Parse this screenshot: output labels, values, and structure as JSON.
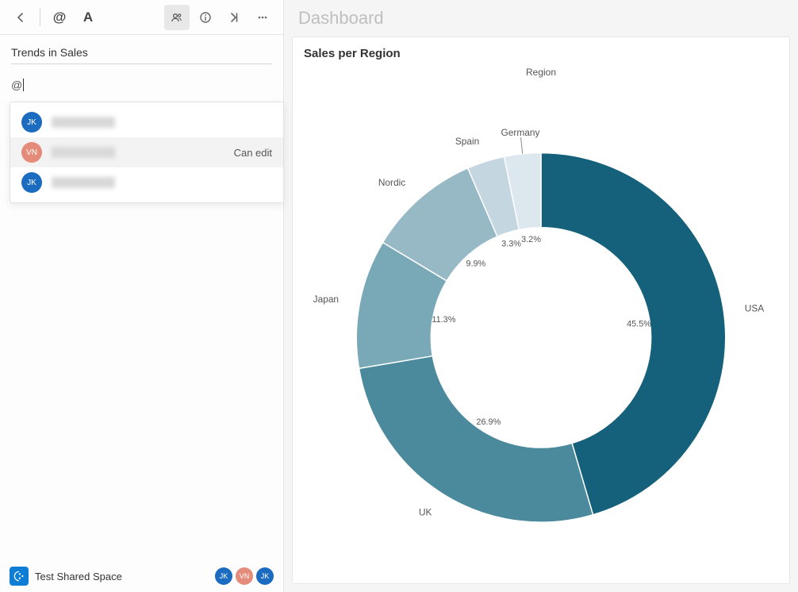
{
  "sidebar": {
    "note_title": "Trends in Sales",
    "mention_input": "@",
    "can_edit_label": "Can edit",
    "footer_label": "Test Shared Space",
    "mentions": [
      {
        "initials": "JK",
        "color": "blue",
        "hover": false
      },
      {
        "initials": "VN",
        "color": "coral",
        "hover": true,
        "right": "Can edit"
      },
      {
        "initials": "JK",
        "color": "blue",
        "hover": false
      }
    ],
    "footer_avatars": [
      {
        "initials": "JK",
        "color": "blue"
      },
      {
        "initials": "VN",
        "color": "coral"
      },
      {
        "initials": "JK",
        "color": "blue"
      }
    ]
  },
  "page": {
    "header": "Dashboard",
    "chart_title": "Sales per Region",
    "legend_title": "Region"
  },
  "chart_data": {
    "type": "pie",
    "title": "Sales per Region",
    "legend_title": "Region",
    "donut": true,
    "slices": [
      {
        "label": "USA",
        "value": 45.5,
        "color": "#15607a"
      },
      {
        "label": "UK",
        "value": 26.9,
        "color": "#4a8a9c"
      },
      {
        "label": "Japan",
        "value": 11.3,
        "color": "#79a8b7"
      },
      {
        "label": "Nordic",
        "value": 9.9,
        "color": "#97b9c6"
      },
      {
        "label": "Spain",
        "value": 3.3,
        "color": "#c4d6df"
      },
      {
        "label": "Germany",
        "value": 3.2,
        "color": "#dde7ee"
      }
    ]
  }
}
